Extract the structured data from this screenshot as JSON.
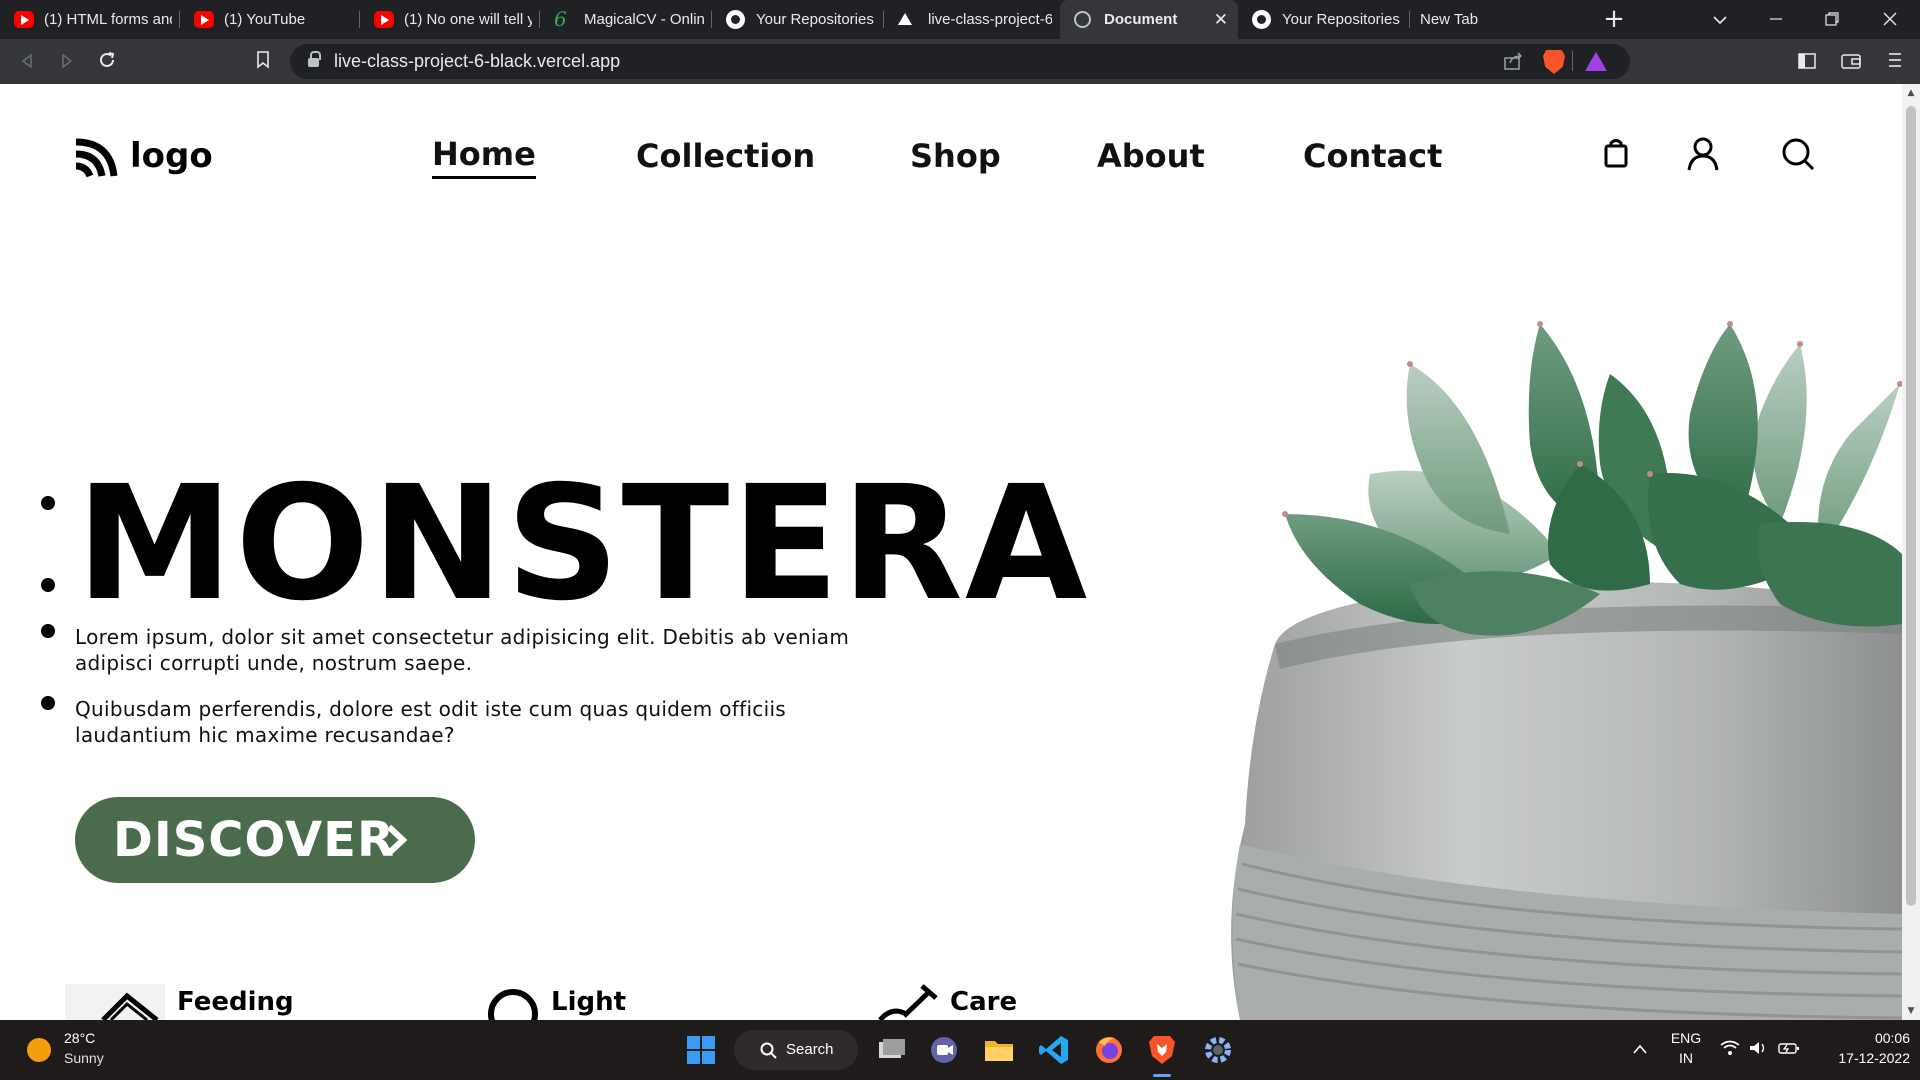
{
  "browser": {
    "tabs": [
      {
        "title": "(1) HTML forms and",
        "icon": "youtube-icon"
      },
      {
        "title": "(1) YouTube",
        "icon": "youtube-icon"
      },
      {
        "title": "(1) No one will tell y",
        "icon": "youtube-icon"
      },
      {
        "title": "MagicalCV - Online",
        "icon": "magicalcv-icon"
      },
      {
        "title": "Your Repositories",
        "icon": "github-icon"
      },
      {
        "title": "live-class-project-6",
        "icon": "vercel-icon"
      },
      {
        "title": "Document",
        "icon": "globe-icon",
        "active": true
      },
      {
        "title": "Your Repositories",
        "icon": "github-icon"
      },
      {
        "title": "New Tab",
        "icon": ""
      }
    ],
    "new_tab_symbol": "+",
    "close_symbol": "✕",
    "url": "live-class-project-6-black.vercel.app"
  },
  "site": {
    "logo_text": "logo",
    "nav": [
      {
        "label": "Home",
        "active": true
      },
      {
        "label": "Collection"
      },
      {
        "label": "Shop"
      },
      {
        "label": "About"
      },
      {
        "label": "Contact"
      }
    ],
    "hero": {
      "title": "MONSTERA",
      "paragraph_1": "Lorem ipsum, dolor sit amet consectetur adipisicing elit. Debitis ab veniam adipisci corrupti unde, nostrum saepe.",
      "paragraph_2": "Quibusdam perferendis, dolore est odit iste cum quas quidem officiis laudantium hic maxime recusandae?",
      "button_label": "DISCOVER"
    },
    "features": [
      {
        "label": "Feeding"
      },
      {
        "label": "Light"
      },
      {
        "label": "Care"
      }
    ],
    "accent_color": "#4a6b4c"
  },
  "taskbar": {
    "temperature": "28°C",
    "weather": "Sunny",
    "search_label": "Search",
    "language_1": "ENG",
    "language_2": "IN",
    "time": "00:06",
    "date": "17-12-2022"
  }
}
